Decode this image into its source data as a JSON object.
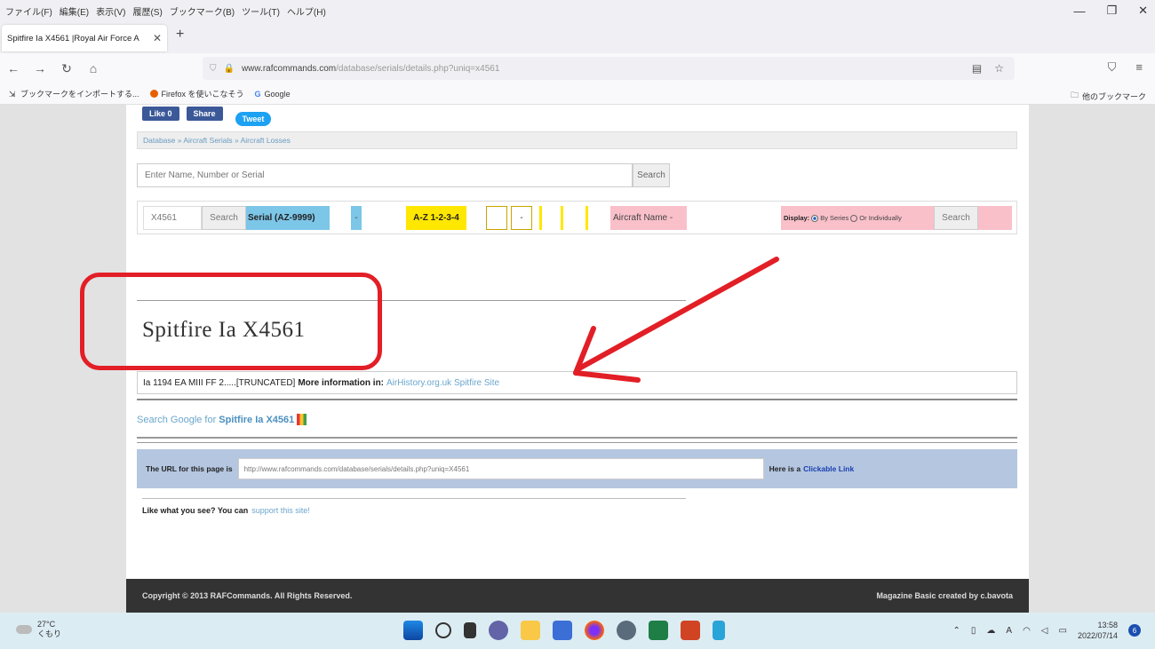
{
  "browser": {
    "menus": [
      "ファイル(F)",
      "編集(E)",
      "表示(V)",
      "履歴(S)",
      "ブックマーク(B)",
      "ツール(T)",
      "ヘルプ(H)"
    ],
    "tab_title": "Spitfire Ia  X4561 |Royal Air Force A",
    "url_domain": "www.rafcommands.com",
    "url_path": "/database/serials/details.php?uniq=x4561",
    "bookmarks": [
      "ブックマークをインポートする...",
      "Firefox を使いこなそう",
      "Google"
    ],
    "other_bookmarks": "他のブックマーク"
  },
  "page": {
    "social": {
      "like": "Like 0",
      "share": "Share",
      "tweet": "Tweet"
    },
    "breadcrumb": "Database » Aircraft Serials » Aircraft Losses",
    "search_placeholder": "Enter Name, Number or Serial",
    "search_button": "Search",
    "filter": {
      "serial_value": "X4561",
      "search1": "Search",
      "serial_label": "Serial (AZ-9999)",
      "dash1": "-",
      "az_label": "A-Z 1-2-3-4",
      "dash2": "-",
      "aircraft_name": "Aircraft Name -",
      "display_label": "Display:",
      "by_series": "By Series",
      "individually": "Or Individually",
      "search2": "Search"
    },
    "title": "Spitfire Ia  X4561",
    "info_text": "Ia 1194 EA MIII FF 2.....[TRUNCATED]",
    "more_info_label": "More information in:",
    "more_info_link": "AirHistory.org.uk Spitfire Site",
    "google_prefix": "Search Google for",
    "google_term": "Spitfire Ia  X4561",
    "url_label": "The URL for this page is",
    "page_url": "http://www.rafcommands.com/database/serials/details.php?uniq=X4561",
    "here_label": "Here is a",
    "clickable_link": "Clickable Link",
    "like_text": "Like what you see? You can",
    "support_link": "support this site!",
    "copyright": "Copyright © 2013 RAFCommands. All Rights Reserved.",
    "credit": "Magazine Basic created by c.bavota"
  },
  "taskbar": {
    "temp": "27°C",
    "weather_sub": "くもり",
    "time": "13:58",
    "date": "2022/07/14",
    "notif": "6",
    "lang": "A"
  },
  "colors": {
    "annotation": "#e21f26",
    "accent_blue": "#7cc6e8",
    "yellow": "#ffe700",
    "pink": "#f9c0ca"
  }
}
